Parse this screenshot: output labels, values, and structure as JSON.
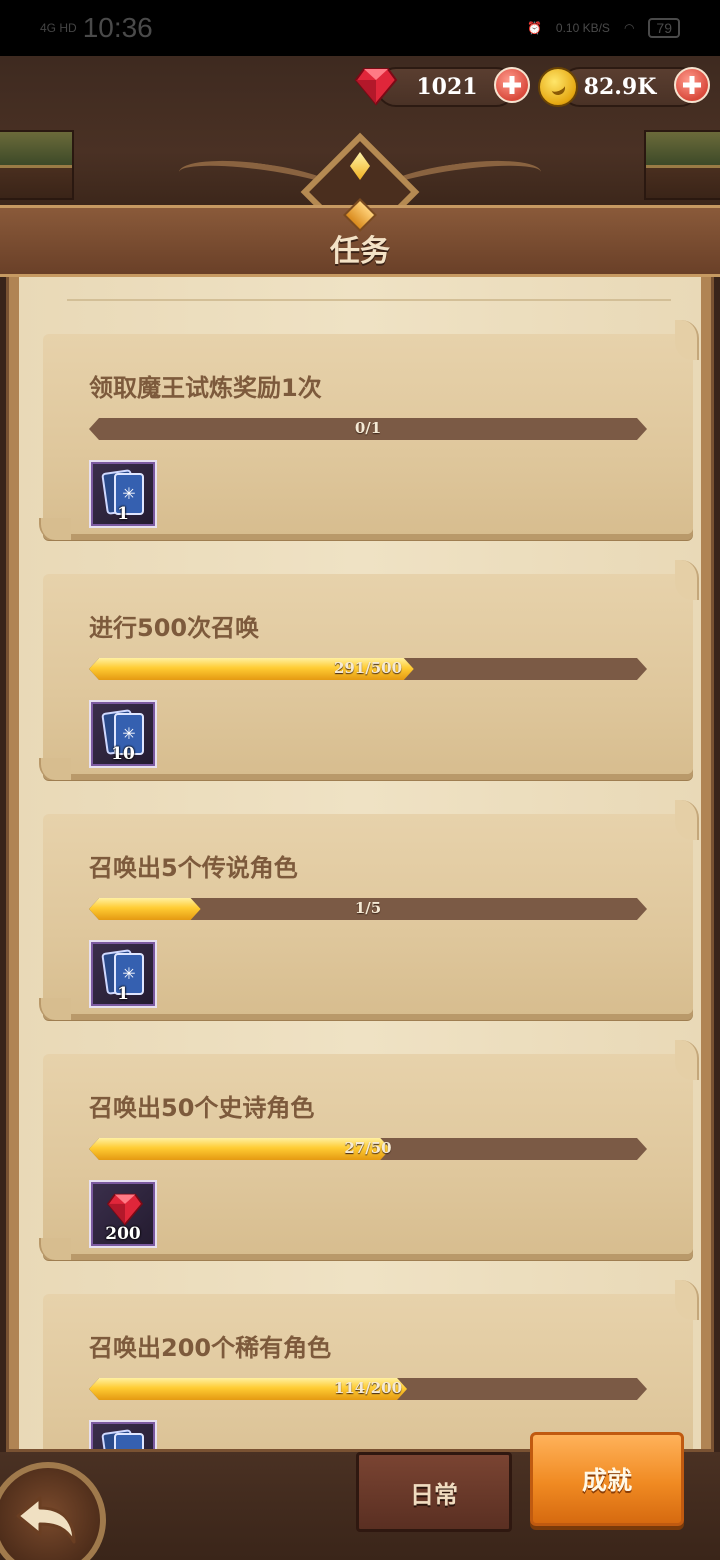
{
  "status_bar": {
    "network": "4G HD",
    "time": "10:36",
    "speed": "0.10 KB/S",
    "battery": "79"
  },
  "resources": {
    "gems": "1021",
    "gold": "82.9K"
  },
  "page": {
    "title": "任务"
  },
  "tasks": [
    {
      "name": "领取魔王试炼奖励1次",
      "progress_text": "0/1",
      "progress": 0.0,
      "reward_type": "card",
      "reward_qty": "1"
    },
    {
      "name": "进行500次召唤",
      "progress_text": "291/500",
      "progress": 0.582,
      "reward_type": "card",
      "reward_qty": "10"
    },
    {
      "name": "召唤出5个传说角色",
      "progress_text": "1/5",
      "progress": 0.2,
      "reward_type": "card",
      "reward_qty": "1"
    },
    {
      "name": "召唤出50个史诗角色",
      "progress_text": "27/50",
      "progress": 0.54,
      "reward_type": "gem",
      "reward_qty": "200"
    },
    {
      "name": "召唤出200个稀有角色",
      "progress_text": "114/200",
      "progress": 0.57,
      "reward_type": "card",
      "reward_qty": ""
    }
  ],
  "tabs": {
    "daily": "日常",
    "achievement": "成就"
  },
  "colors": {
    "progress_fill": "#ffcc33",
    "progress_track": "#7b5a45",
    "active_tab": "#f08a22"
  }
}
